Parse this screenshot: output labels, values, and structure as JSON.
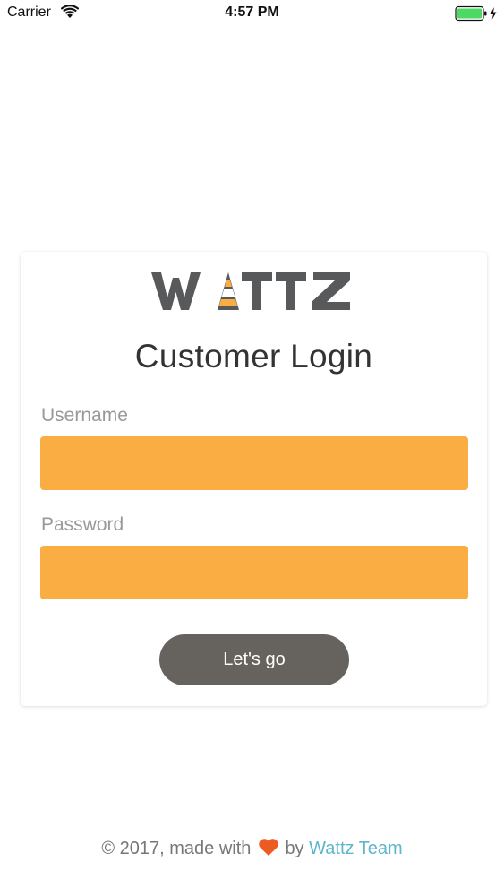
{
  "status_bar": {
    "carrier": "Carrier",
    "time": "4:57 PM",
    "wifi_icon": "wifi-icon",
    "battery_icon": "battery-icon",
    "charging_icon": "charging-bolt-icon",
    "battery_color": "#4cd964"
  },
  "logo": {
    "text": "WATTZ",
    "color": "#58595b",
    "accent_color": "#f9ad42"
  },
  "login": {
    "title": "Customer Login",
    "username_label": "Username",
    "username_value": "",
    "password_label": "Password",
    "password_value": "",
    "submit_label": "Let's go",
    "input_color": "#f9ad42",
    "button_color": "#66625d"
  },
  "footer": {
    "prefix": "© 2017, made with",
    "heart_icon": "heart-icon",
    "heart_color": "#ee5a24",
    "by": "by",
    "team_link": "Wattz Team",
    "link_color": "#5fb5cc"
  }
}
